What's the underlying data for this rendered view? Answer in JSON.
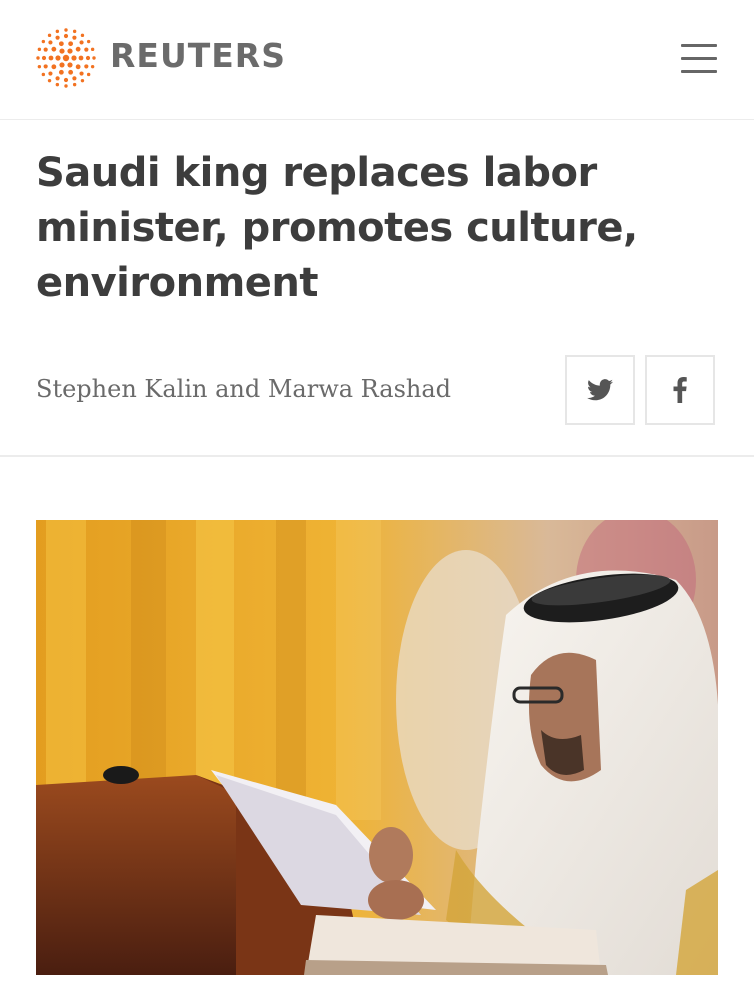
{
  "header": {
    "brand": "REUTERS",
    "logo_icon": "reuters-dot-logo-icon",
    "menu_icon": "hamburger-menu-icon",
    "brand_color": "#f27221"
  },
  "article": {
    "headline_lines": [
      "Saudi king replaces labor",
      "minister, promotes culture,",
      "environment"
    ],
    "byline": "Stephen Kalin and Marwa Rashad",
    "share": {
      "twitter_icon": "twitter-icon",
      "facebook_icon": "facebook-icon"
    },
    "photo_icon": "article-photo"
  }
}
